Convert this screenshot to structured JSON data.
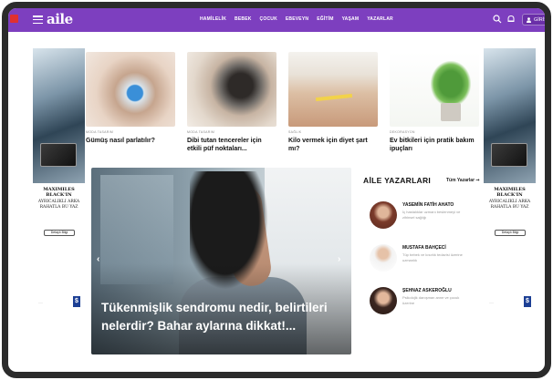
{
  "header": {
    "logo": "aile",
    "nav": [
      "HAMİLELİK",
      "BEBEK",
      "ÇOCUK",
      "EBEVEYN",
      "EĞİTİM",
      "YAŞAM",
      "YAZARLAR"
    ],
    "login_label": "GİRİŞ",
    "accent_color": "#7d3fbf"
  },
  "ads": {
    "left": {
      "title": "MAXIMILES BLACK'IN",
      "sub": "AYRICALIKLI ARKA RAHATLA BU YAZ",
      "button": "Detaylı Bilgi"
    },
    "right": {
      "title": "MAXIMILES BLACK'IN",
      "sub": "AYRICALIKLI ARKA RAHATLA BU YAZ",
      "button": "Detaylı Bilgi"
    }
  },
  "articles": [
    {
      "category": "MODA TASARIM",
      "title": "Gümüş nasıl parlatılır?"
    },
    {
      "category": "MODA TASARIM",
      "title": "Dibi tutan tencereler için etkili püf noktaları..."
    },
    {
      "category": "SAĞLIK",
      "title": "Kilo vermek için diyet şart mı?"
    },
    {
      "category": "DEKORASYON",
      "title": "Ev bitkileri için pratik bakım ipuçları"
    }
  ],
  "hero": {
    "title": "Tükenmişlik sendromu nedir, belirtileri nelerdir? Bahar aylarına dikkat!..."
  },
  "writers": {
    "title": "AİLE YAZARLARI",
    "all_label": "Tüm Yazarlar ➞",
    "items": [
      {
        "name": "YASEMİN FATİH AHATO",
        "desc": "İç hastalıklar uzmanı beslenmeyi ve zihinsel sağlığı"
      },
      {
        "name": "MUSTAFA BAHÇECİ",
        "desc": "Tüp bebek ve kısırlık tedavisi üzerine uzmanlık"
      },
      {
        "name": "ŞEHNAZ ASKEROĞLU",
        "desc": "Psikolojik danışman anne ve çocuk üzerine"
      }
    ]
  }
}
